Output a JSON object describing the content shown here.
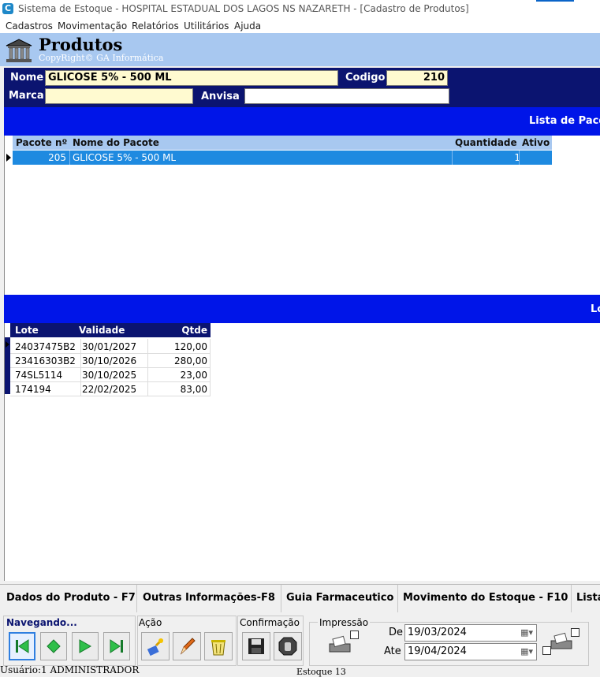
{
  "window": {
    "title": "Sistema de Estoque - HOSPITAL ESTADUAL DOS LAGOS NS NAZARETH - [Cadastro de Produtos]"
  },
  "menu": [
    "Cadastros",
    "Movimentação",
    "Relatórios",
    "Utilitários",
    "Ajuda"
  ],
  "header": {
    "title": "Produtos",
    "subtitle": "CopyRight© GA Informática",
    "icon": "building-icon"
  },
  "form": {
    "nome_label": "Nome",
    "nome_value": "GLICOSE 5% - 500 ML",
    "codigo_label": "Codigo",
    "codigo_value": "210",
    "marca_label": "Marca",
    "marca_value": "",
    "anvisa_label": "Anvisa",
    "anvisa_value": ""
  },
  "pacotes": {
    "band_title": "Lista de Pacot",
    "columns": [
      "Pacote nº",
      "Nome do Pacote",
      "Quantidade",
      "Ativo"
    ],
    "rows": [
      {
        "pacote": "205",
        "nome": "GLICOSE 5% - 500 ML",
        "quantidade": "1",
        "ativo": ""
      }
    ]
  },
  "lotes": {
    "band_title": "Lo",
    "columns": [
      "Lote",
      "Validade",
      "Qtde"
    ],
    "rows": [
      {
        "lote": "24037475B2",
        "validade": "30/01/2027",
        "qtde": "120,00"
      },
      {
        "lote": "23416303B2",
        "validade": "30/10/2026",
        "qtde": "280,00"
      },
      {
        "lote": "74SL5114",
        "validade": "30/10/2025",
        "qtde": "23,00"
      },
      {
        "lote": "174194",
        "validade": "22/02/2025",
        "qtde": "83,00"
      }
    ]
  },
  "tabs": [
    "Dados do Produto - F7",
    "Outras Informações-F8",
    "Guia Farmaceutico",
    "Movimento do Estoque - F10",
    "Lista"
  ],
  "toolbar": {
    "nav_label": "Navegando...",
    "acao_label": "Ação",
    "confirmacao_label": "Confirmação",
    "impressao_label": "Impressão",
    "de_label": "De",
    "de_value": "19/03/2024",
    "ate_label": "Ate",
    "ate_value": "19/04/2024"
  },
  "status": {
    "user": "Usuário:1 ADMINISTRADOR",
    "extra": "Estoque 13"
  },
  "colors": {
    "dark_navy": "#0b1470",
    "bright_blue": "#0015e8",
    "header_blue": "#a8c8f0",
    "field_yellow": "#fffad0",
    "selection_blue": "#1e8ae0"
  }
}
